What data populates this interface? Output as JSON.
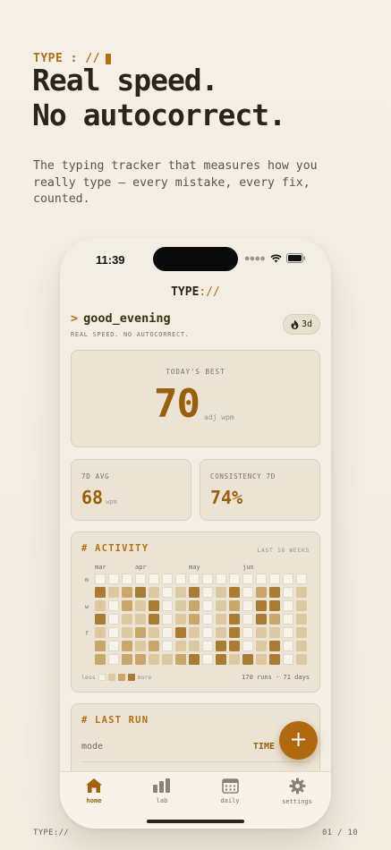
{
  "hero": {
    "eyebrow": "TYPE : //",
    "headline_1": "Real speed.",
    "headline_2": "No autocorrect.",
    "lede": "The typing tracker that measures how you really type — every mistake, every fix, counted."
  },
  "footer": {
    "left": "TYPE://",
    "right": "01 / 10"
  },
  "status": {
    "time": "11:39"
  },
  "app": {
    "title_main": "TYPE",
    "title_accent": "://",
    "greeting_prompt": ">",
    "greeting": "good_evening",
    "tagline": "REAL SPEED. NO AUTOCORRECT.",
    "streak": "3d"
  },
  "best": {
    "label": "TODAY'S BEST",
    "value": "70",
    "unit": "adj wpm"
  },
  "avg": {
    "label": "7D AVG",
    "value": "68",
    "unit": "wpm"
  },
  "consistency": {
    "label": "CONSISTENCY 7D",
    "value": "74%"
  },
  "activity": {
    "title": "# ACTIVITY",
    "range": "LAST 16 WEEKS",
    "months": [
      "mar",
      "apr",
      "may",
      "jun"
    ],
    "day_labels": [
      "m",
      "w",
      "f"
    ],
    "legend_less": "less",
    "legend_more": "more",
    "summary": "170 runs · 71 days",
    "weeks": [
      [
        0,
        3,
        1,
        3,
        1,
        2,
        2
      ],
      [
        0,
        1,
        0,
        0,
        0,
        0,
        0
      ],
      [
        0,
        2,
        2,
        1,
        1,
        2,
        2
      ],
      [
        0,
        3,
        1,
        1,
        2,
        1,
        2
      ],
      [
        0,
        1,
        3,
        3,
        1,
        2,
        1
      ],
      [
        0,
        0,
        0,
        0,
        0,
        0,
        1
      ],
      [
        0,
        1,
        1,
        1,
        3,
        1,
        2
      ],
      [
        0,
        3,
        2,
        2,
        1,
        1,
        3
      ],
      [
        0,
        0,
        0,
        0,
        0,
        0,
        0
      ],
      [
        0,
        1,
        1,
        1,
        1,
        3,
        3
      ],
      [
        0,
        3,
        2,
        3,
        3,
        3,
        1
      ],
      [
        0,
        0,
        0,
        0,
        0,
        0,
        3
      ],
      [
        0,
        2,
        3,
        3,
        1,
        1,
        1
      ],
      [
        0,
        3,
        3,
        2,
        1,
        3,
        3
      ],
      [
        0,
        0,
        0,
        0,
        0,
        0,
        0
      ],
      [
        0,
        1,
        1,
        1,
        1,
        1,
        1
      ]
    ]
  },
  "last_run": {
    "title": "# LAST RUN",
    "mode_label": "mode",
    "mode_value": "TIME"
  },
  "fab": {
    "label": "+"
  },
  "tabs": [
    {
      "label": "home",
      "icon": "home-icon"
    },
    {
      "label": "lab",
      "icon": "bar-chart-icon"
    },
    {
      "label": "daily",
      "icon": "calendar-icon"
    },
    {
      "label": "settings",
      "icon": "gear-icon"
    }
  ],
  "colors": {
    "accent": "#b36e12",
    "value": "#9a5f0c",
    "background": "#f3eee4",
    "card": "#ebe4d5"
  }
}
